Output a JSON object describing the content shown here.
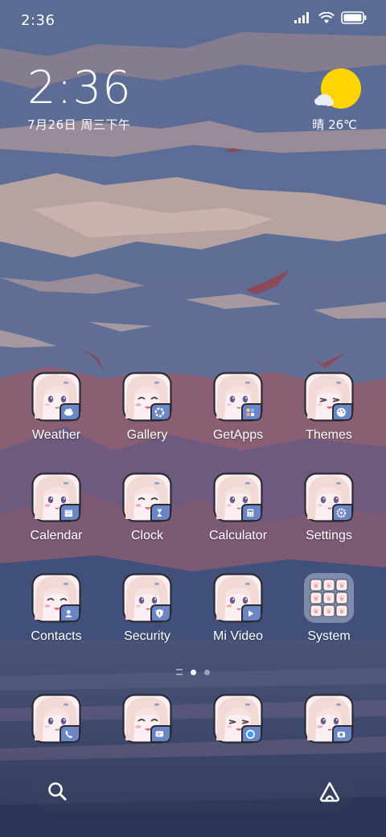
{
  "status_bar": {
    "time": "2:36",
    "icons": [
      "signal-icon",
      "wifi-icon",
      "battery-icon"
    ]
  },
  "clock_widget": {
    "time": "2:36",
    "date": "7月26日 周三下午"
  },
  "weather_widget": {
    "condition": "晴",
    "temperature": "26℃",
    "display": "晴 26℃",
    "icon": "sun-cloud-icon"
  },
  "apps": [
    {
      "label": "Weather",
      "badge": "cloud-icon",
      "face": "happy"
    },
    {
      "label": "Gallery",
      "badge": "flower-icon",
      "face": "laugh"
    },
    {
      "label": "GetApps",
      "badge": "apps-icon",
      "face": "neutral"
    },
    {
      "label": "Themes",
      "badge": "palette-icon",
      "face": "wink"
    },
    {
      "label": "Calendar",
      "badge": "calendar-icon",
      "face": "blush"
    },
    {
      "label": "Clock",
      "badge": "hourglass-icon",
      "face": "laugh"
    },
    {
      "label": "Calculator",
      "badge": "calculator-icon",
      "face": "neutral"
    },
    {
      "label": "Settings",
      "badge": "gear-icon",
      "face": "neutral"
    },
    {
      "label": "Contacts",
      "badge": "contact-icon",
      "face": "laugh"
    },
    {
      "label": "Security",
      "badge": "shield-icon",
      "face": "neutral"
    },
    {
      "label": "Mi Video",
      "badge": "play-icon",
      "face": "blush"
    },
    {
      "label": "System",
      "badge": "folder",
      "face": "folder"
    }
  ],
  "page_indicator": {
    "pages": 2,
    "active": 1
  },
  "dock": [
    {
      "name": "phone",
      "badge": "phone-icon",
      "face": "neutral"
    },
    {
      "name": "messages",
      "badge": "message-icon",
      "face": "laugh"
    },
    {
      "name": "browser",
      "badge": "browser-icon",
      "face": "wink"
    },
    {
      "name": "camera",
      "badge": "camera-icon",
      "face": "blush"
    }
  ],
  "colors": {
    "sky": "#5d6d92",
    "cloud": "#b7a2a2",
    "mountain": "#8a5f74",
    "sea": "#3f4a6e",
    "sun": "#ffd400",
    "icon_bg": "#fbeff1",
    "hair": "#f3d9d6",
    "badge": "#6b86c4"
  }
}
